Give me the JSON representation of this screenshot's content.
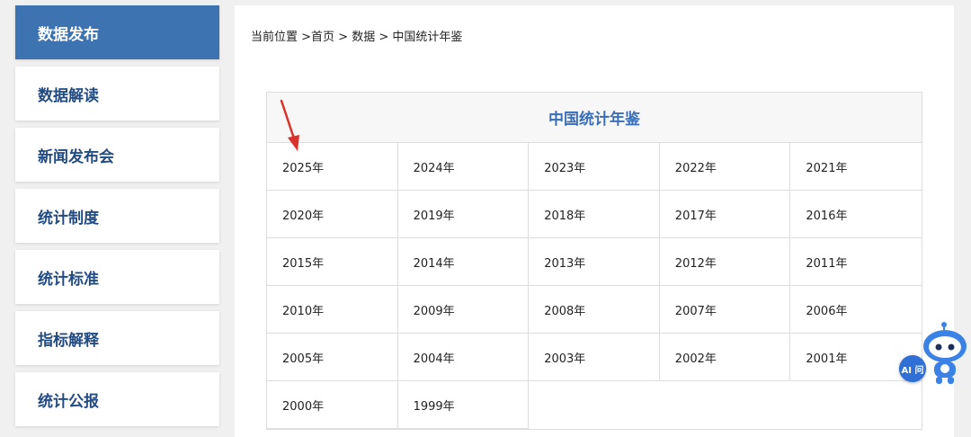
{
  "sidebar": {
    "items": [
      {
        "label": "数据发布",
        "active": true
      },
      {
        "label": "数据解读"
      },
      {
        "label": "新闻发布会"
      },
      {
        "label": "统计制度"
      },
      {
        "label": "统计标准"
      },
      {
        "label": "指标解释"
      },
      {
        "label": "统计公报"
      }
    ]
  },
  "breadcrumb": {
    "prefix": "当前位置 >",
    "home": "首页",
    "sep": " > ",
    "data": "数据",
    "current": "中国统计年鉴"
  },
  "table": {
    "title": "中国统计年鉴",
    "years": [
      "2025年",
      "2024年",
      "2023年",
      "2022年",
      "2021年",
      "2020年",
      "2019年",
      "2018年",
      "2017年",
      "2016年",
      "2015年",
      "2014年",
      "2013年",
      "2012年",
      "2011年",
      "2010年",
      "2009年",
      "2008年",
      "2007年",
      "2006年",
      "2005年",
      "2004年",
      "2003年",
      "2002年",
      "2001年",
      "2000年",
      "1999年"
    ]
  },
  "ai_assistant": {
    "label": "AI 问"
  },
  "colors": {
    "sidebar_active": "#3e73b1",
    "sidebar_text": "#224b82",
    "title_blue": "#3a6fb8",
    "arrow_red": "#d9322b"
  }
}
